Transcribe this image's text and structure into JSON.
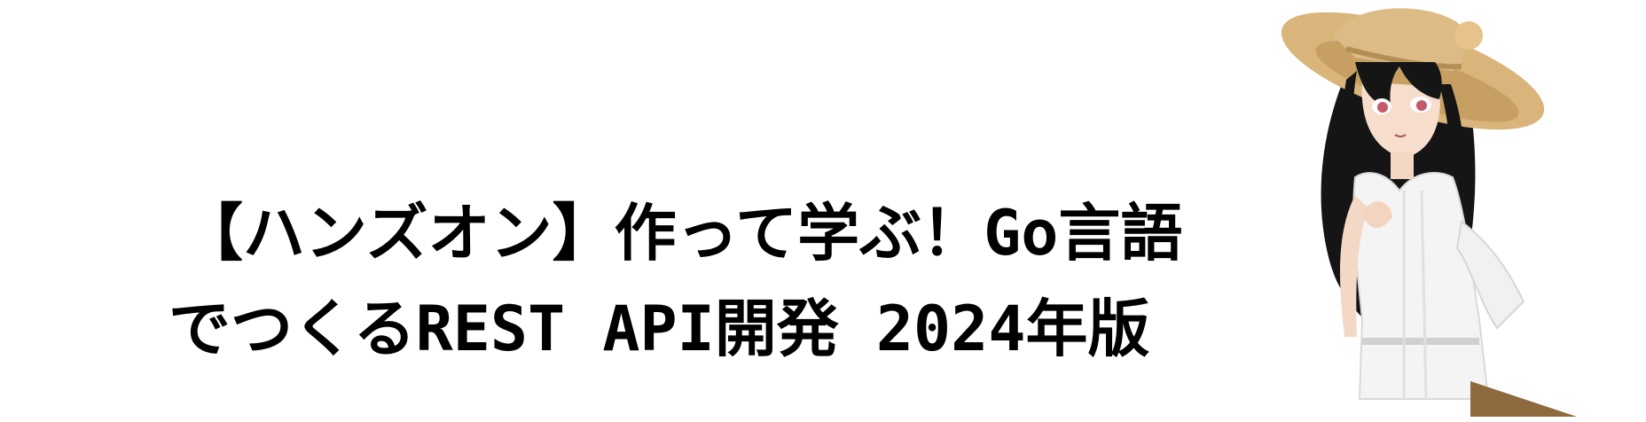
{
  "title": {
    "line1": "【ハンズオン】作って学ぶ！Go言語",
    "line2": "でつくるREST API開発 2024年版"
  },
  "illustration": {
    "icon": "anime-girl-straw-hat-illustration",
    "colors": {
      "hat": "#d8b47a",
      "hair": "#151515",
      "skin": "#f6dccb",
      "dress": "#f2f2f2",
      "eyes": "#c85a6a"
    }
  }
}
